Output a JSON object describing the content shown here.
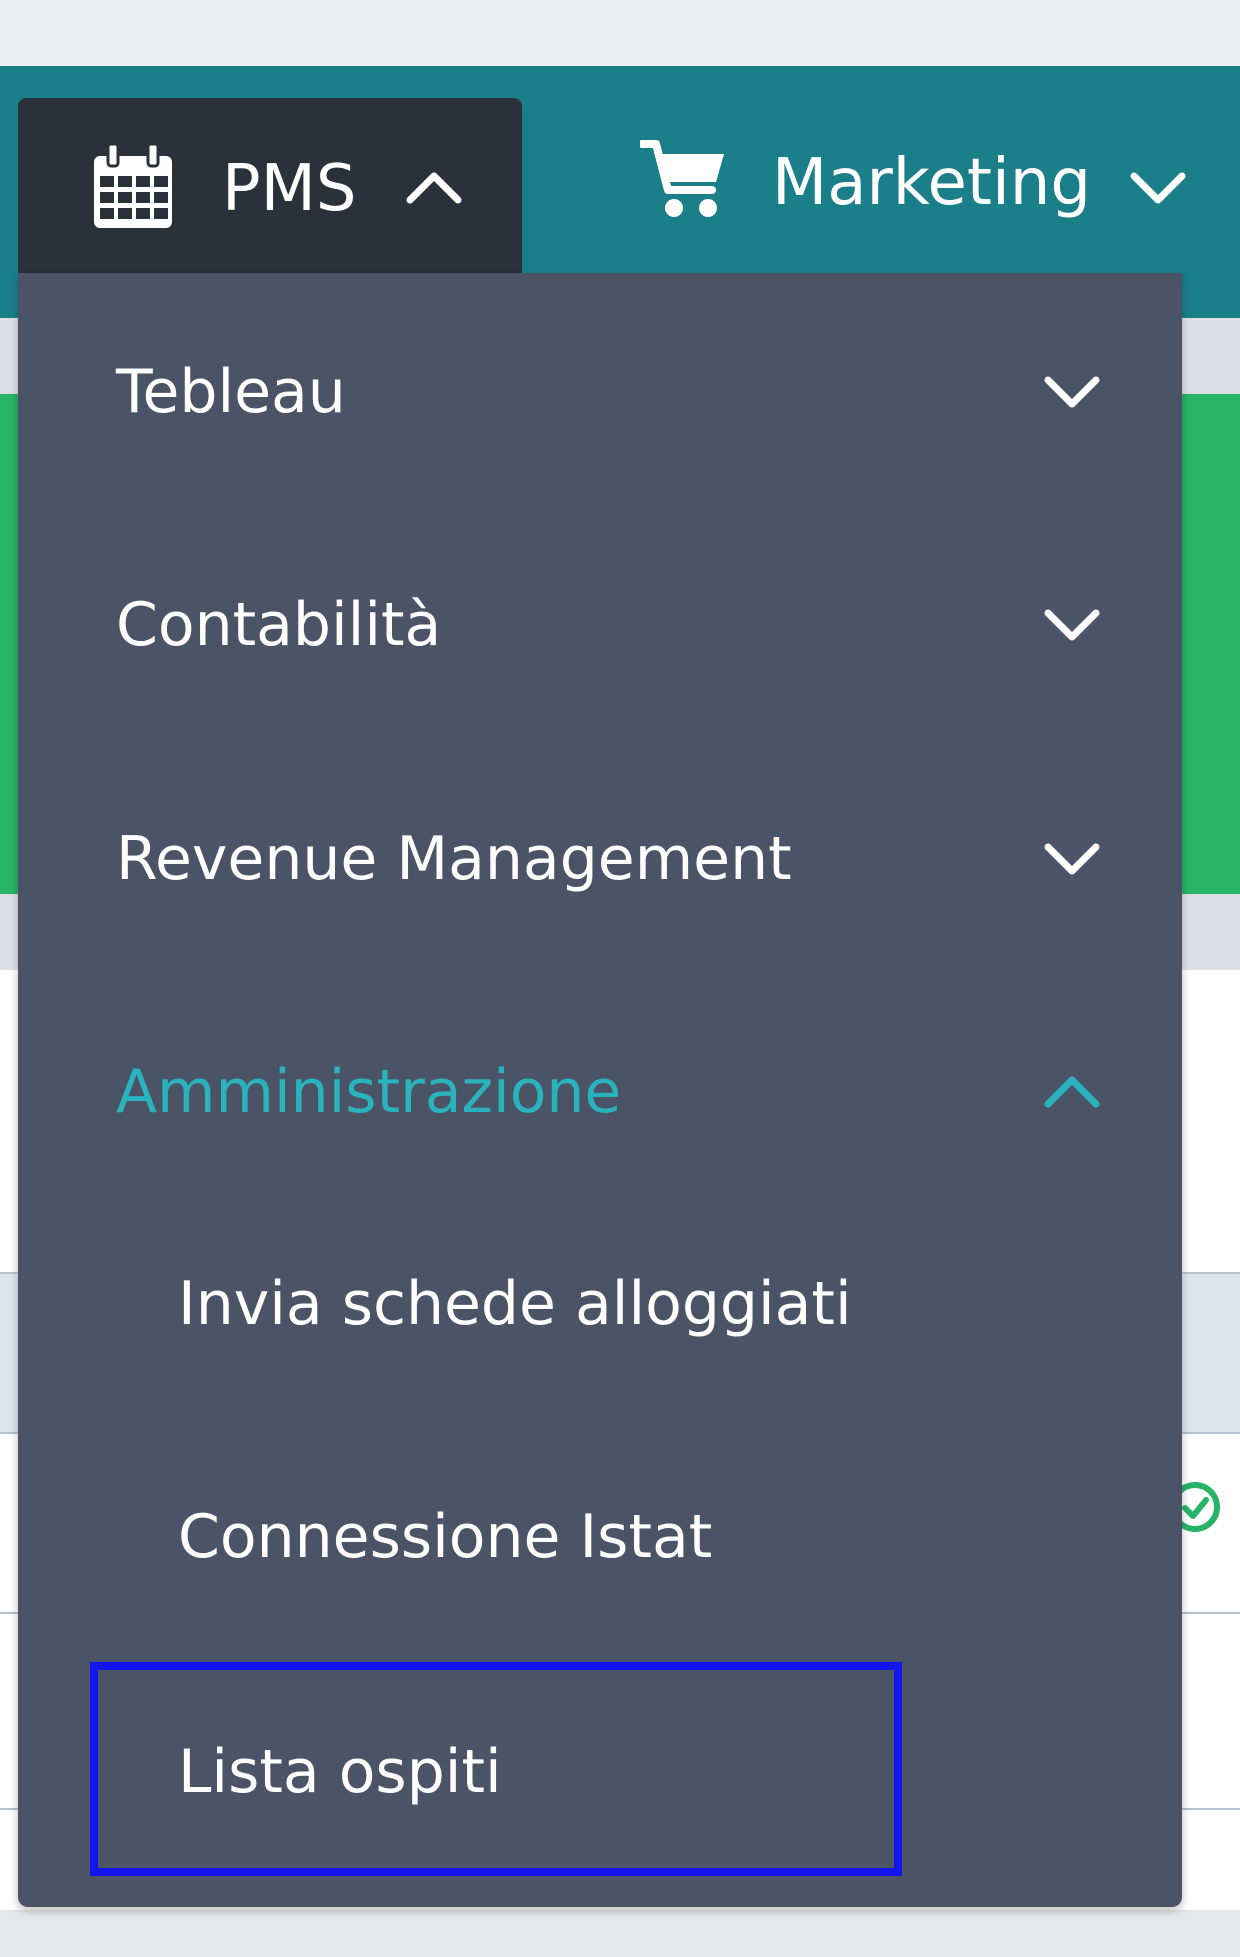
{
  "navbar": {
    "pms": {
      "label": "PMS",
      "icon": "calendar-icon",
      "state": "expanded"
    },
    "marketing": {
      "label": "Marketing",
      "icon": "cart-icon",
      "state": "collapsed"
    }
  },
  "dropdown": {
    "items": [
      {
        "label": "Tebleau",
        "expanded": false
      },
      {
        "label": "Contabilità",
        "expanded": false
      },
      {
        "label": "Revenue Management",
        "expanded": false
      },
      {
        "label": "Amministrazione",
        "expanded": true
      }
    ],
    "subitems": [
      {
        "label": "Invia schede alloggiati"
      },
      {
        "label": "Connessione Istat"
      },
      {
        "label": "Lista ospiti",
        "highlighted": true
      }
    ]
  },
  "colors": {
    "navbar": "#1b7f8a",
    "pms_tab": "#2b313b",
    "dropdown_bg": "#4a5466",
    "active_text": "#2ab3bd",
    "highlight_border": "#1414f0",
    "status_green": "#28b466"
  }
}
